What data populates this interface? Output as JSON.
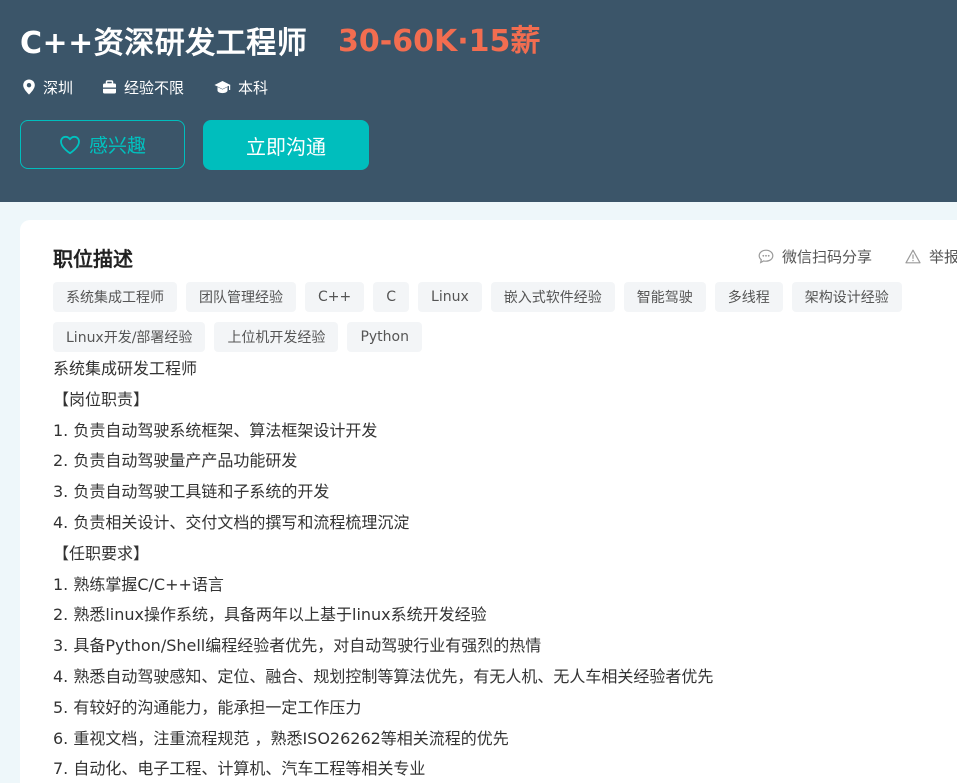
{
  "job": {
    "title": "C++资深研发工程师",
    "salary": "30-60K·15薪",
    "location": "深圳",
    "experience": "经验不限",
    "education": "本科"
  },
  "actions": {
    "interest_label": "感兴趣",
    "chat_label": "立即沟通"
  },
  "description": {
    "section_title": "职位描述",
    "share_label": "微信扫码分享",
    "report_label": "举报",
    "tags": [
      "系统集成工程师",
      "团队管理经验",
      "C++",
      "C",
      "Linux",
      "嵌入式软件经验",
      "智能驾驶",
      "多线程",
      "架构设计经验",
      "Linux开发/部署经验",
      "上位机开发经验",
      "Python"
    ],
    "lines": [
      "系统集成研发工程师",
      "【岗位职责】",
      "1. 负责自动驾驶系统框架、算法框架设计开发",
      "2. 负责自动驾驶量产产品功能研发",
      "3. 负责自动驾驶工具链和子系统的开发",
      "4. 负责相关设计、交付文档的撰写和流程梳理沉淀",
      "【任职要求】",
      "1. 熟练掌握C/C++语言",
      "2. 熟悉linux操作系统，具备两年以上基于linux系统开发经验",
      "3. 具备Python/Shell编程经验者优先，对自动驾驶行业有强烈的热情",
      "4. 熟悉自动驾驶感知、定位、融合、规划控制等算法优先，有无人机、无人车相关经验者优先",
      "5. 有较好的沟通能力，能承担一定工作压力",
      "6. 重视文档，注重流程规范 ，熟悉ISO26262等相关流程的优先",
      "7. 自动化、电子工程、计算机、汽车工程等相关专业"
    ]
  },
  "colors": {
    "header_bg": "#3b5569",
    "accent": "#00bebd",
    "salary": "#f26d50"
  },
  "icons": [
    "location-pin-icon",
    "briefcase-icon",
    "graduation-cap-icon",
    "heart-icon",
    "chat-bubble-icon",
    "warning-icon"
  ]
}
